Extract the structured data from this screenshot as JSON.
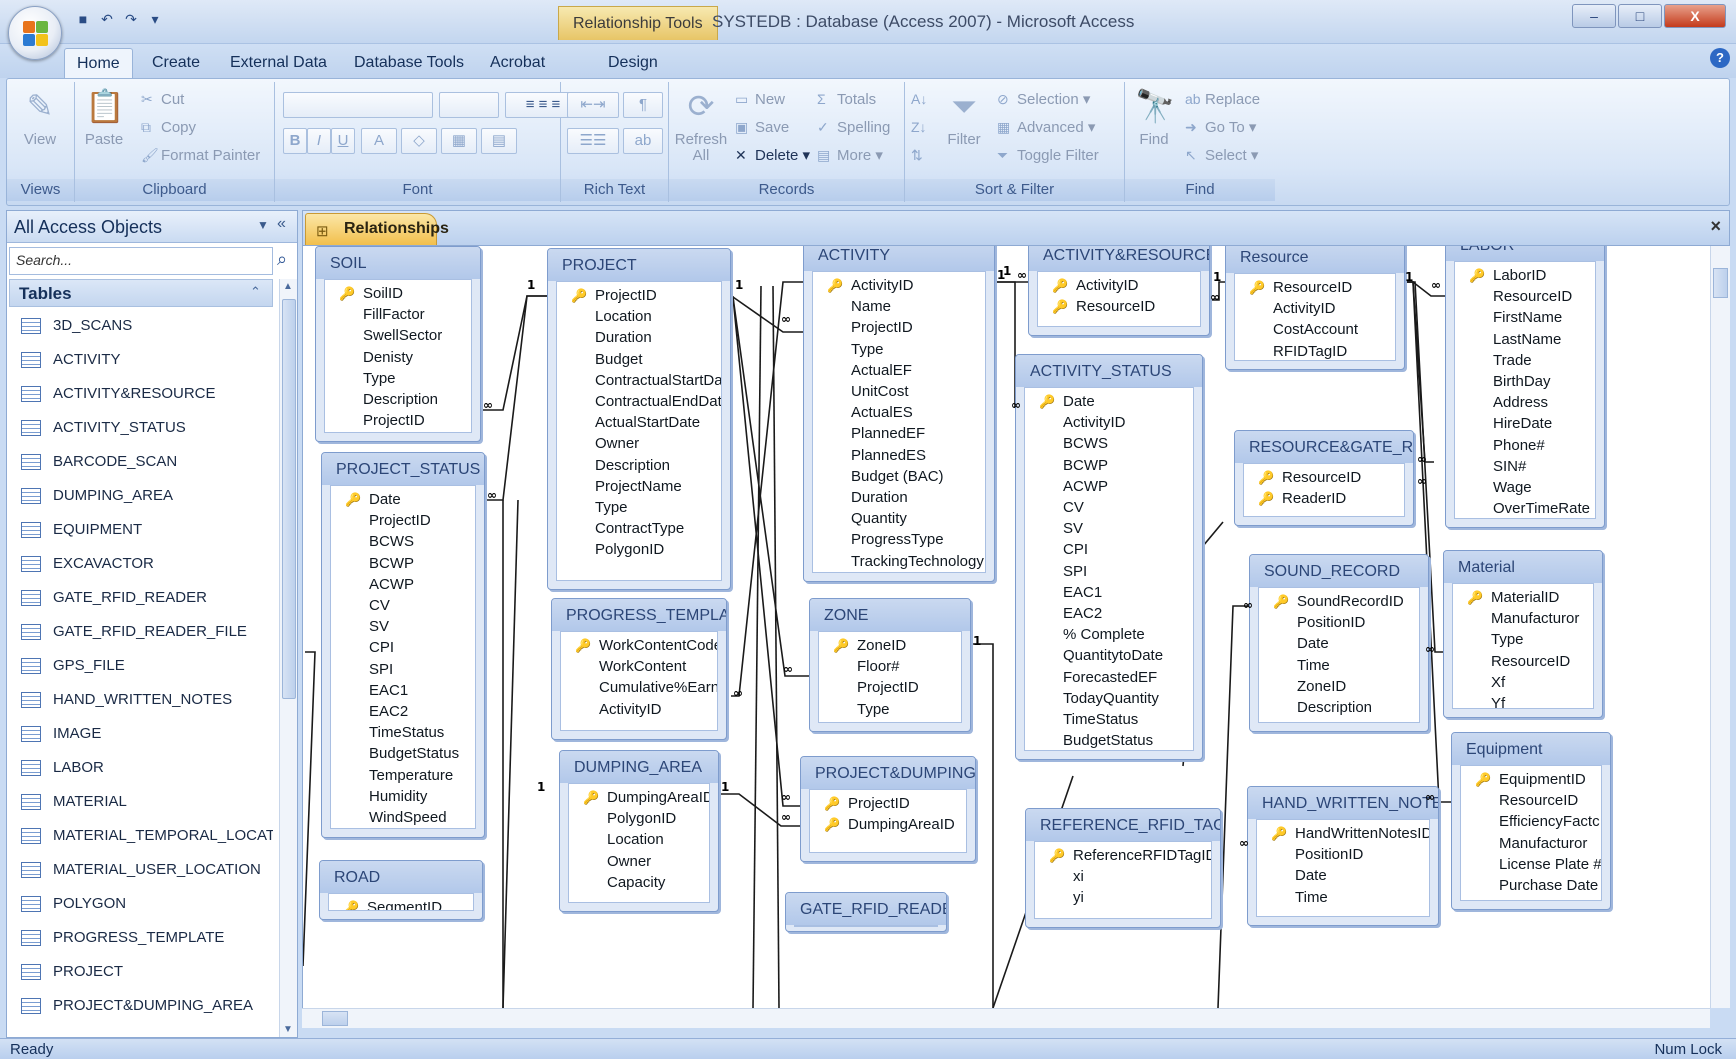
{
  "window": {
    "context_tab": "Relationship Tools",
    "title": "SYSTEDB : Database (Access 2007) - Microsoft Access",
    "controls": [
      "–",
      "□",
      "X"
    ]
  },
  "ribbon_tabs": [
    "Home",
    "Create",
    "External Data",
    "Database Tools",
    "Acrobat",
    "Design"
  ],
  "ribbon": {
    "views": {
      "label": "Views",
      "view": "View"
    },
    "clipboard": {
      "label": "Clipboard",
      "paste": "Paste",
      "cut": "Cut",
      "copy": "Copy",
      "format_painter": "Format Painter"
    },
    "font": {
      "label": "Font",
      "bold": "B",
      "italic": "I",
      "underline": "U",
      "font_color": "A"
    },
    "rich_text": {
      "label": "Rich Text"
    },
    "records": {
      "label": "Records",
      "refresh": "Refresh All",
      "new": "New",
      "save": "Save",
      "delete": "Delete",
      "totals": "Totals",
      "spelling": "Spelling",
      "more": "More"
    },
    "sort_filter": {
      "label": "Sort & Filter",
      "filter": "Filter",
      "selection": "Selection",
      "advanced": "Advanced",
      "toggle_filter": "Toggle Filter"
    },
    "find": {
      "label": "Find",
      "find": "Find",
      "replace": "Replace",
      "goto": "Go To",
      "select": "Select"
    }
  },
  "nav": {
    "title": "All Access Objects",
    "search_placeholder": "Search...",
    "group_label": "Tables",
    "tables": [
      "3D_SCANS",
      "ACTIVITY",
      "ACTIVITY&RESOURCE",
      "ACTIVITY_STATUS",
      "BARCODE_SCAN",
      "DUMPING_AREA",
      "EQUIPMENT",
      "EXCAVACTOR",
      "GATE_RFID_READER",
      "GATE_RFID_READER_FILE",
      "GPS_FILE",
      "HAND_WRITTEN_NOTES",
      "IMAGE",
      "LABOR",
      "MATERIAL",
      "MATERIAL_TEMPORAL_LOCATI...",
      "MATERIAL_USER_LOCATION",
      "POLYGON",
      "PROGRESS_TEMPLATE",
      "PROJECT",
      "PROJECT&DUMPING_AREA"
    ]
  },
  "document_tab": "Relationships",
  "relationship_tables": [
    {
      "name": "SOIL",
      "fields": [
        "SoilID",
        "FillFactor",
        "SwellSector",
        "Denisty",
        "Type",
        "Description",
        "ProjectID"
      ],
      "keys": [
        0
      ]
    },
    {
      "name": "PROJECT_STATUS",
      "fields": [
        "Date",
        "ProjectID",
        "BCWS",
        "BCWP",
        "ACWP",
        "CV",
        "SV",
        "CPI",
        "SPI",
        "EAC1",
        "EAC2",
        "TimeStatus",
        "BudgetStatus",
        "Temperature",
        "Humidity",
        "WindSpeed"
      ],
      "keys": [
        0
      ]
    },
    {
      "name": "ROAD",
      "fields": [
        "SegmentID"
      ],
      "keys": [
        0
      ]
    },
    {
      "name": "PROJECT",
      "fields": [
        "ProjectID",
        "Location",
        "Duration",
        "Budget",
        "ContractualStartDate",
        "ContractualEndDate",
        "ActualStartDate",
        "Owner",
        "Description",
        "ProjectName",
        "Type",
        "ContractType",
        "PolygonID"
      ],
      "keys": [
        0
      ]
    },
    {
      "name": "PROGRESS_TEMPLATE",
      "fields": [
        "WorkContentCode",
        "WorkContent",
        "Cumulative%Earned",
        "ActivityID"
      ],
      "keys": [
        0
      ]
    },
    {
      "name": "DUMPING_AREA",
      "fields": [
        "DumpingAreaID",
        "PolygonID",
        "Location",
        "Owner",
        "Capacity"
      ],
      "keys": [
        0
      ]
    },
    {
      "name": "ACTIVITY",
      "fields": [
        "ActivityID",
        "Name",
        "ProjectID",
        "Type",
        "ActualEF",
        "UnitCost",
        "ActualES",
        "PlannedEF",
        "PlannedES",
        "Budget (BAC)",
        "Duration",
        "Quantity",
        "ProgressType",
        "TrackingTechnology"
      ],
      "keys": [
        0
      ]
    },
    {
      "name": "ZONE",
      "fields": [
        "ZoneID",
        "Floor#",
        "ProjectID",
        "Type"
      ],
      "keys": [
        0
      ]
    },
    {
      "name": "PROJECT&DUMPING...",
      "fields": [
        "ProjectID",
        "DumpingAreaID"
      ],
      "keys": [
        0,
        1
      ]
    },
    {
      "name": "GATE_RFID_READER",
      "fields": [],
      "keys": []
    },
    {
      "name": "ACTIVITY&RESOURCE",
      "fields": [
        "ActivityID",
        "ResourceID"
      ],
      "keys": [
        0,
        1
      ]
    },
    {
      "name": "ACTIVITY_STATUS",
      "fields": [
        "Date",
        "ActivityID",
        "BCWS",
        "BCWP",
        "ACWP",
        "CV",
        "SV",
        "CPI",
        "SPI",
        "EAC1",
        "EAC2",
        "% Complete",
        "QuantitytoDate",
        "ForecastedEF",
        "TodayQuantity",
        "TimeStatus",
        "BudgetStatus"
      ],
      "keys": [
        0
      ]
    },
    {
      "name": "REFERENCE_RFID_TAG",
      "fields": [
        "ReferenceRFIDTagID",
        "xi",
        "yi"
      ],
      "keys": [
        0
      ]
    },
    {
      "name": "Resource",
      "fields": [
        "ResourceID",
        "ActivityID",
        "CostAccount",
        "RFIDTagID"
      ],
      "keys": [
        0
      ]
    },
    {
      "name": "RESOURCE&GATE_R...",
      "fields": [
        "ResourceID",
        "ReaderID"
      ],
      "keys": [
        0,
        1
      ]
    },
    {
      "name": "SOUND_RECORD",
      "fields": [
        "SoundRecordID",
        "PositionID",
        "Date",
        "Time",
        "ZoneID",
        "Description"
      ],
      "keys": [
        0
      ]
    },
    {
      "name": "HAND_WRITTEN_NOTES",
      "fields": [
        "HandWrittenNotesID",
        "PositionID",
        "Date",
        "Time"
      ],
      "keys": [
        0
      ]
    },
    {
      "name": "LABOR",
      "fields": [
        "LaborID",
        "ResourceID",
        "FirstName",
        "LastName",
        "Trade",
        "BirthDay",
        "Address",
        "HireDate",
        "Phone#",
        "SIN#",
        "Wage",
        "OverTimeRate"
      ],
      "keys": [
        0
      ]
    },
    {
      "name": "Material",
      "fields": [
        "MaterialID",
        "Manufacturor",
        "Type",
        "ResourceID",
        "Xf",
        "Yf"
      ],
      "keys": [
        0
      ]
    },
    {
      "name": "Equipment",
      "fields": [
        "EquipmentID",
        "ResourceID",
        "EfficiencyFactc",
        "Manufacturor",
        "License Plate #",
        "Purchase Date"
      ],
      "keys": [
        0
      ]
    }
  ],
  "relationship_labels": {
    "one": "1",
    "many": "∞"
  },
  "status": {
    "left": "Ready",
    "right": "Num Lock"
  }
}
